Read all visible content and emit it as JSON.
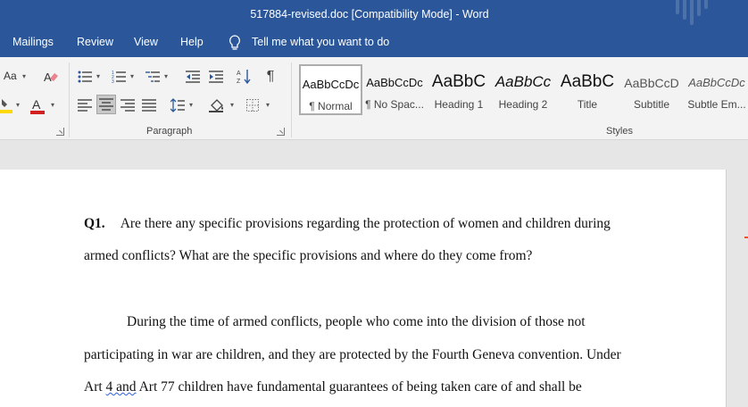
{
  "title": "517884-revised.doc [Compatibility Mode]  -  Word",
  "menu": [
    "Mailings",
    "Review",
    "View",
    "Help"
  ],
  "tell_me": "Tell me what you want to do",
  "ribbon": {
    "font_size_label": "Aa",
    "font_color_letter": "A",
    "paragraph_label": "Paragraph",
    "styles_label": "Styles"
  },
  "styles": [
    {
      "sample": "AaBbCcDc",
      "name": "¶ Normal"
    },
    {
      "sample": "AaBbCcDc",
      "name": "¶ No Spac..."
    },
    {
      "sample": "AaBbC",
      "name": "Heading 1"
    },
    {
      "sample": "AaBbCc",
      "name": "Heading 2"
    },
    {
      "sample": "AaBbC",
      "name": "Title"
    },
    {
      "sample": "AaBbCcD",
      "name": "Subtitle"
    },
    {
      "sample": "AaBbCcDc",
      "name": "Subtle Em..."
    }
  ],
  "document": {
    "q_label": "Q1.",
    "q_line1": "Are there any specific provisions regarding the protection of women and children during",
    "q_line2": "armed conflicts? What are the specific provisions and where do they come from?",
    "a_line1": "During the time of armed conflicts, people who come into the division of those not",
    "a_line2": "participating in war are children, and they are protected by the Fourth Geneva convention. Under",
    "a_line3_pre": "Art ",
    "a_line3_flag": "4  and",
    "a_line3_post": " Art 77 children have fundamental guarantees of being taken care of and shall be"
  },
  "colors": {
    "titlebar": "#2b579a",
    "ribbon": "#f3f3f3",
    "highlight_yellow": "#ffd800",
    "font_red": "#d21f1f"
  }
}
